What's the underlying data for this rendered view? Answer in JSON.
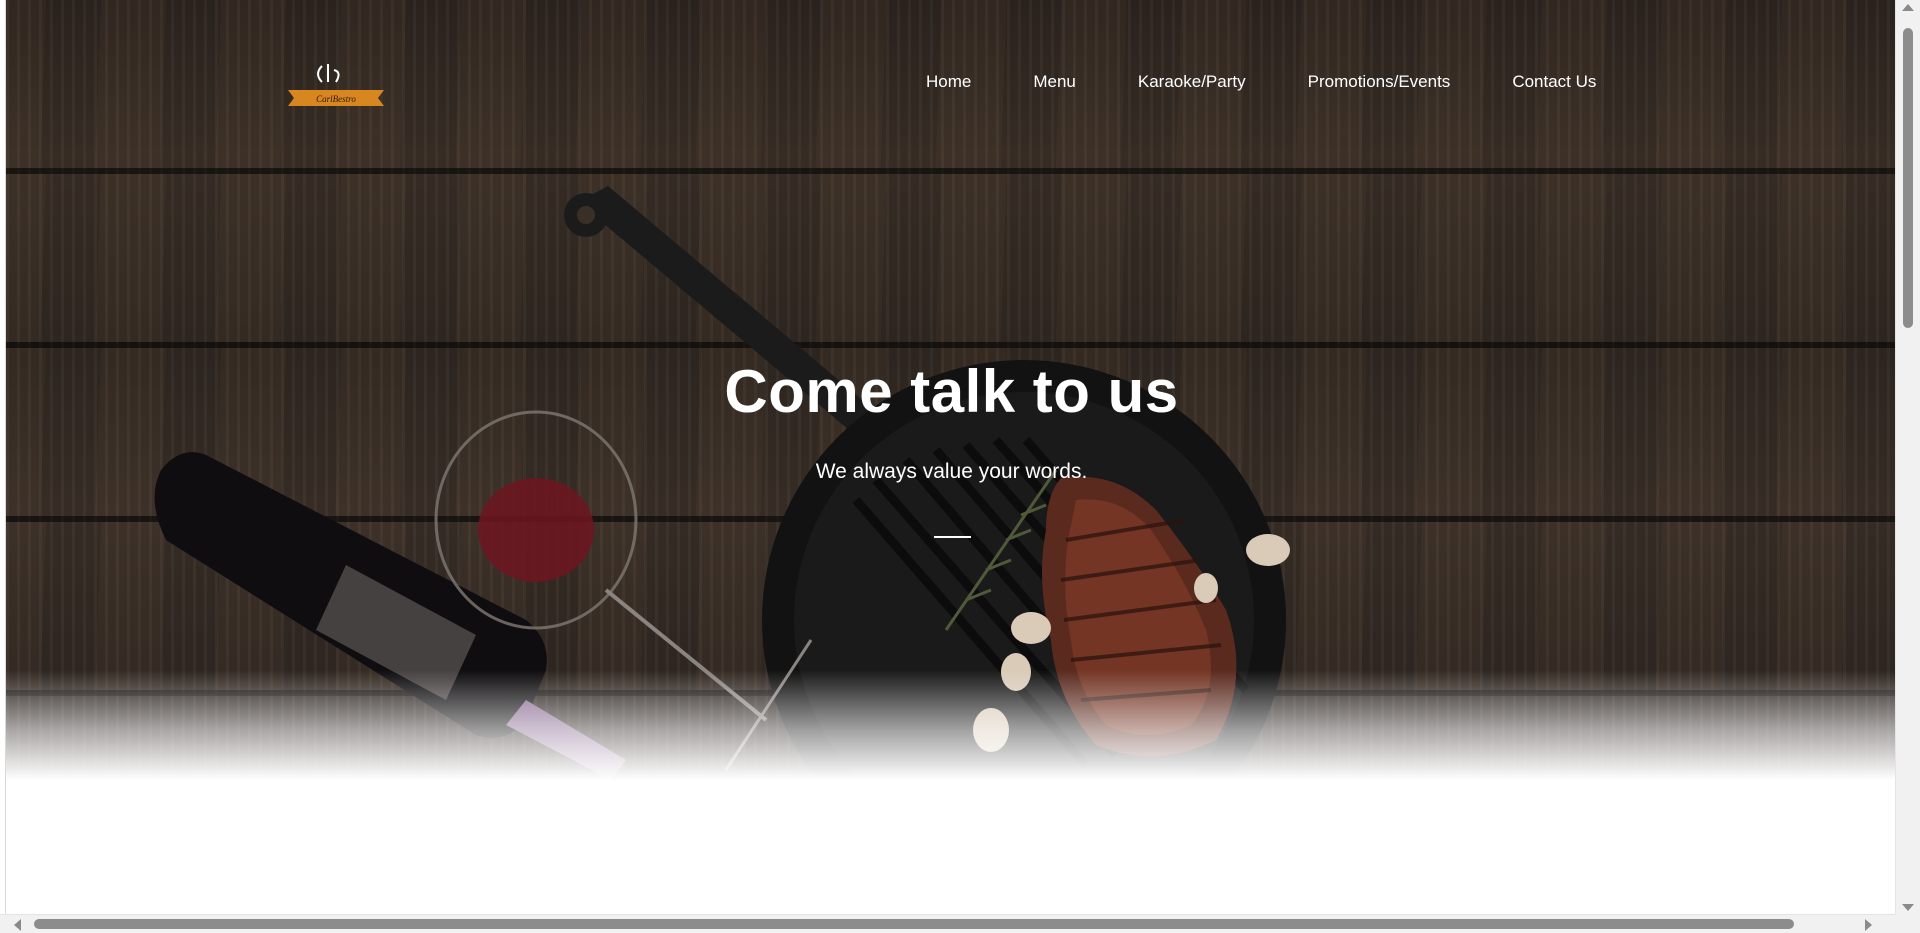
{
  "brand": {
    "logo_text": "CarlBestro"
  },
  "nav": {
    "items": [
      {
        "label": "Home"
      },
      {
        "label": "Menu"
      },
      {
        "label": "Karaoke/Party"
      },
      {
        "label": "Promotions/Events"
      },
      {
        "label": "Contact Us"
      }
    ]
  },
  "hero": {
    "title": "Come talk to us",
    "subtitle": "We always value your words."
  },
  "colors": {
    "logo_ribbon": "#d8861f",
    "hero_text": "#ffffff",
    "wood_base": "#2f2721"
  }
}
